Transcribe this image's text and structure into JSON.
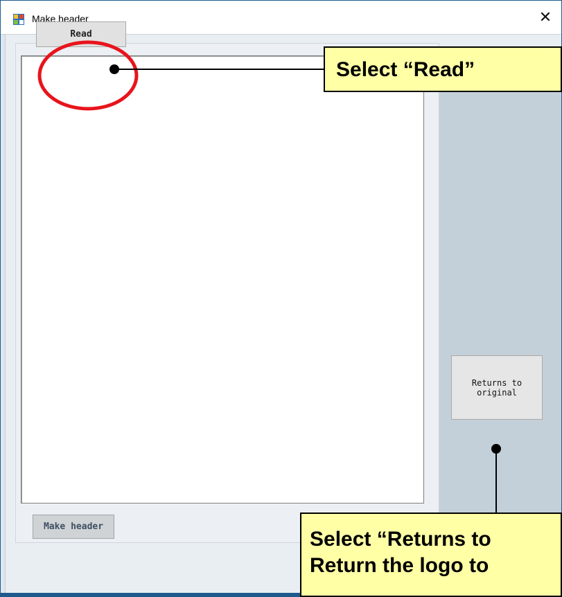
{
  "window": {
    "title": "Make header",
    "close_glyph": "✕"
  },
  "buttons": {
    "read": "Read",
    "returns_to_original": "Returns to\noriginal",
    "make_header": "Make header"
  },
  "annotations": {
    "read_callout": "Select “Read”",
    "returns_callout_line1": "Select “Returns to",
    "returns_callout_line2": "Return the logo to"
  },
  "colors": {
    "highlight_ring": "#e8141c",
    "callout_fill": "#ffffa6",
    "right_panel": "#c4d0d9"
  },
  "icons": {
    "app": "app-window-icon",
    "close": "close-icon"
  }
}
